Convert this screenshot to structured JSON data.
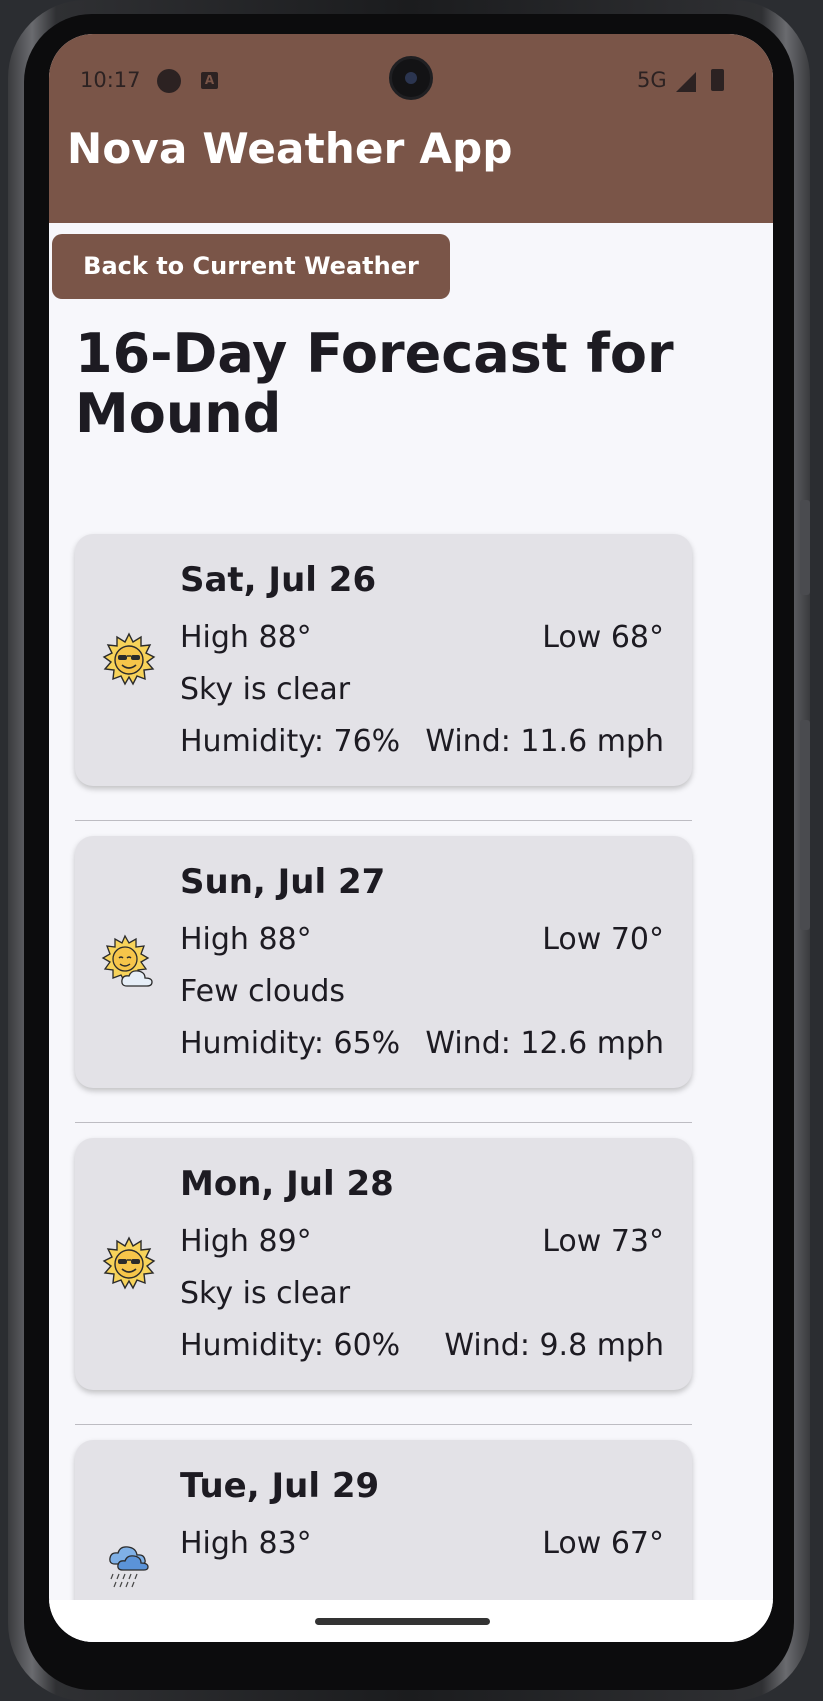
{
  "status_bar": {
    "time": "10:17",
    "network": "5G"
  },
  "app": {
    "title": "Nova Weather App"
  },
  "back_button_label": "Back to Current Weather",
  "heading": "16-Day Forecast for Mound",
  "colors": {
    "primary": "#7a5548",
    "card": "#e3e2e7",
    "background": "#f7f7fb"
  },
  "forecast": [
    {
      "date": "Sat, Jul 26",
      "high": "High 88°",
      "low": "Low 68°",
      "description": "Sky is clear",
      "humidity": "Humidity: 76%",
      "wind": "Wind: 11.6 mph",
      "icon": "sun-with-sunglasses-icon"
    },
    {
      "date": "Sun, Jul 27",
      "high": "High 88°",
      "low": "Low 70°",
      "description": "Few clouds",
      "humidity": "Humidity: 65%",
      "wind": "Wind: 12.6 mph",
      "icon": "sun-behind-cloud-icon"
    },
    {
      "date": "Mon, Jul 28",
      "high": "High 89°",
      "low": "Low 73°",
      "description": "Sky is clear",
      "humidity": "Humidity: 60%",
      "wind": "Wind: 9.8 mph",
      "icon": "sun-with-sunglasses-icon"
    },
    {
      "date": "Tue, Jul 29",
      "high": "High 83°",
      "low": "Low 67°",
      "description": "",
      "humidity": "",
      "wind": "",
      "icon": "rain-cloud-icon"
    }
  ]
}
